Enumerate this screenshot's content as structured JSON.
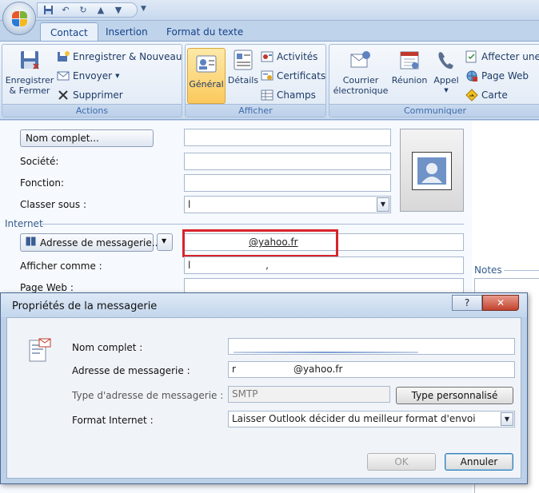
{
  "tabs": [
    {
      "label": "Contact",
      "active": true
    },
    {
      "label": "Insertion",
      "active": false
    },
    {
      "label": "Format du texte",
      "active": false
    }
  ],
  "ribbon": {
    "actions": {
      "label": "Actions",
      "save_close": [
        "Enregistrer",
        "& Fermer"
      ],
      "save_new": "Enregistrer & Nouveau",
      "send": "Envoyer",
      "delete": "Supprimer"
    },
    "show": {
      "label": "Afficher",
      "general": "Général",
      "details": "Détails",
      "activities": "Activités",
      "certificates": "Certificats",
      "fields": "Champs"
    },
    "communicate": {
      "label": "Communiquer",
      "email": [
        "Courrier",
        "électronique"
      ],
      "meeting": "Réunion",
      "call": "Appel",
      "assign": "Affecter une t",
      "webpage": "Page Web",
      "map": "Carte"
    }
  },
  "form": {
    "full_name_button": "Nom complet...",
    "company_label": "Société:",
    "job_label": "Fonction:",
    "file_as_label": "Classer sous :",
    "file_as_value": "l",
    "internet_section": "Internet",
    "email_button": "Adresse de messagerie...",
    "email_value": "@yahoo.fr",
    "display_as_label": "Afficher comme :",
    "display_as_value": "l",
    "display_as_suffix": ",",
    "webpage_label": "Page Web :",
    "notes_label": "Notes"
  },
  "dialog": {
    "title": "Propriétés de la messagerie",
    "help_button": "?",
    "close_button": "✕",
    "full_name_label": "Nom complet :",
    "email_label": "Adresse de messagerie :",
    "email_prefix": "r",
    "email_value": "@yahoo.fr",
    "type_label": "Type d'adresse de messagerie :",
    "type_value": "SMTP",
    "custom_type_button": "Type personnalisé",
    "format_label": "Format Internet :",
    "format_value": "Laisser Outlook décider du meilleur format d'envoi",
    "ok_button": "OK",
    "cancel_button": "Annuler"
  },
  "colors": {
    "accent": "#15428b",
    "highlight_box": "#d8232a",
    "selected_button": "#fbc95c"
  }
}
